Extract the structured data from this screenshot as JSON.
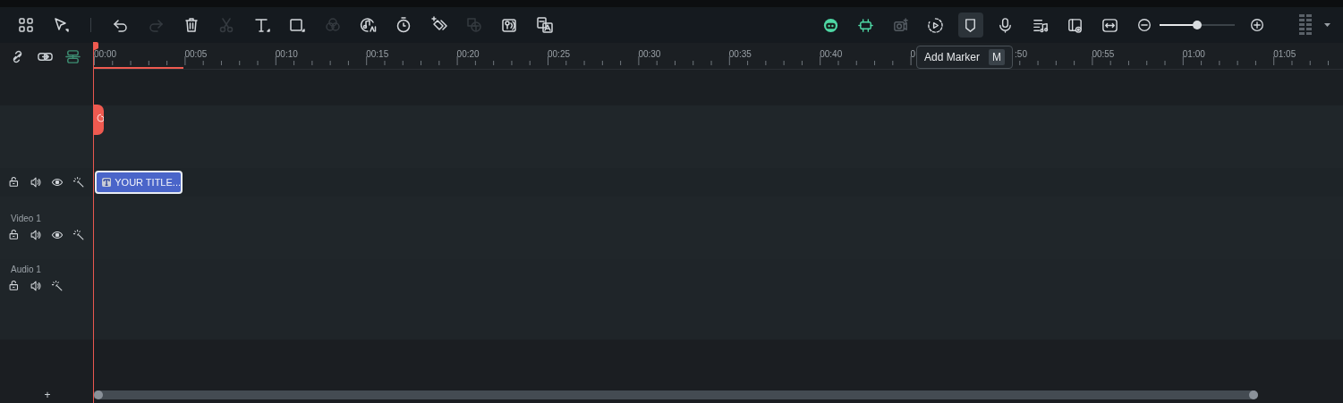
{
  "toolbar": {
    "left": [
      {
        "kind": "apps",
        "disabled": false
      },
      {
        "kind": "select",
        "disabled": false
      },
      {
        "kind": "separator"
      },
      {
        "kind": "undo",
        "disabled": false
      },
      {
        "kind": "redo",
        "disabled": true
      },
      {
        "kind": "delete",
        "disabled": false
      },
      {
        "kind": "cut",
        "disabled": true
      },
      {
        "kind": "text",
        "disabled": false
      },
      {
        "kind": "shape",
        "disabled": false
      },
      {
        "kind": "color",
        "disabled": true
      },
      {
        "kind": "ai-audio",
        "disabled": false
      },
      {
        "kind": "timer",
        "disabled": false
      },
      {
        "kind": "keyframe",
        "disabled": false
      },
      {
        "kind": "text-effect",
        "disabled": true
      },
      {
        "kind": "voice",
        "disabled": false
      },
      {
        "kind": "translate",
        "disabled": false
      }
    ],
    "right": [
      {
        "kind": "robot",
        "disabled": false,
        "selected": false
      },
      {
        "kind": "chip",
        "disabled": false,
        "selected": false
      },
      {
        "kind": "camera",
        "disabled": true,
        "selected": false
      },
      {
        "kind": "play-circle",
        "disabled": false,
        "selected": false
      },
      {
        "kind": "marker",
        "disabled": false,
        "selected": true
      },
      {
        "kind": "mic",
        "disabled": false,
        "selected": false
      },
      {
        "kind": "music-list",
        "disabled": false,
        "selected": false
      },
      {
        "kind": "screen-eye",
        "disabled": false,
        "selected": false
      },
      {
        "kind": "fit",
        "disabled": false,
        "selected": false
      }
    ],
    "zoom": {
      "level": 0.5
    },
    "tooltip": {
      "label": "Add Marker",
      "shortcut": "M"
    }
  },
  "ruler": {
    "labels": [
      {
        "text": "00:00",
        "cut_left": false
      },
      {
        "text": "00:05",
        "cut_left": false
      },
      {
        "text": "00:10",
        "cut_left": false
      },
      {
        "text": "00:15",
        "cut_left": false
      },
      {
        "text": "00:20",
        "cut_left": false
      },
      {
        "text": "00:25",
        "cut_left": false
      },
      {
        "text": "00:30",
        "cut_left": false
      },
      {
        "text": "00:35",
        "cut_left": false
      },
      {
        "text": "00:40",
        "cut_left": false
      },
      {
        "text": "0",
        "cut_left": false
      },
      {
        "text": ":50",
        "cut_left": true
      },
      {
        "text": "00:55",
        "cut_left": false
      },
      {
        "text": "01:00",
        "cut_left": false
      },
      {
        "text": "01:05",
        "cut_left": false
      }
    ],
    "header_tools": [
      {
        "kind": "unlink",
        "active": false
      },
      {
        "kind": "link",
        "active": false
      },
      {
        "kind": "tracks",
        "active": true
      }
    ]
  },
  "tracks": [
    {
      "kind": "title",
      "controls": [
        {
          "kind": "lock"
        },
        {
          "kind": "audio"
        },
        {
          "kind": "eye"
        },
        {
          "kind": "magic"
        }
      ],
      "clip": {
        "label": "YOUR TITLE...",
        "selected": true
      }
    },
    {
      "kind": "video",
      "name": "Video 1",
      "controls": [
        {
          "kind": "lock"
        },
        {
          "kind": "audio"
        },
        {
          "kind": "eye"
        },
        {
          "kind": "magic"
        }
      ]
    },
    {
      "kind": "audio",
      "name": "Audio 1",
      "controls": [
        {
          "kind": "lock"
        },
        {
          "kind": "audio"
        },
        {
          "kind": "magic"
        }
      ]
    }
  ],
  "add_track": "+"
}
